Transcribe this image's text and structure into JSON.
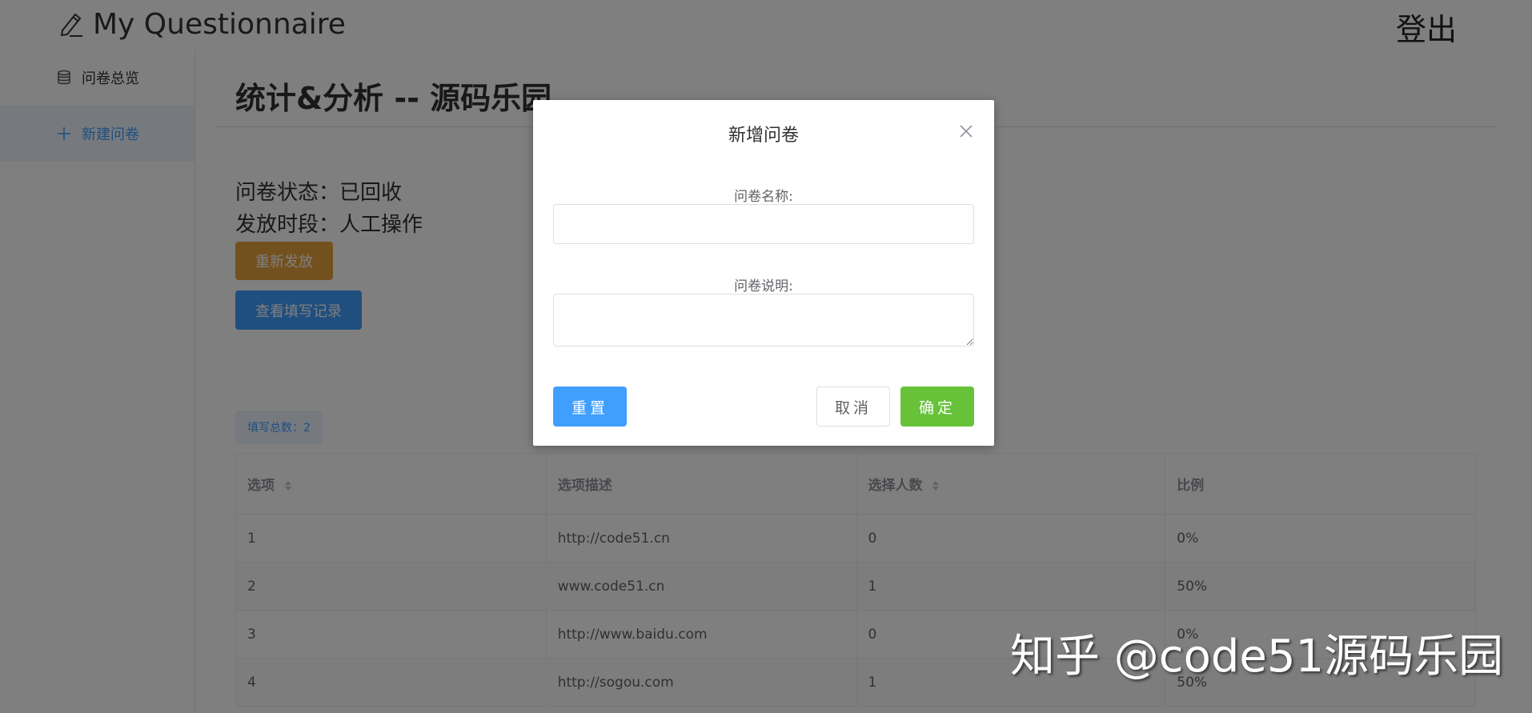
{
  "header": {
    "title": "My Questionnaire",
    "logout_label": "登出"
  },
  "sidebar": {
    "items": [
      {
        "label": "问卷总览",
        "icon": "database-icon",
        "active": false
      },
      {
        "label": "新建问卷",
        "icon": "plus-icon",
        "active": true
      }
    ]
  },
  "main": {
    "title": "统计&分析 -- 源码乐园",
    "status_line": "问卷状态：已回收",
    "period_line": "发放时段：人工操作",
    "redistribute_label": "重新发放",
    "view_records_label": "查看填写记录",
    "total_count_label": "填写总数：2",
    "table": {
      "columns": [
        "选项",
        "选项描述",
        "选择人数",
        "比例"
      ],
      "rows": [
        [
          "1",
          "http://code51.cn",
          "0",
          "0%"
        ],
        [
          "2",
          "www.code51.cn",
          "1",
          "50%"
        ],
        [
          "3",
          "http://www.baidu.com",
          "0",
          "0%"
        ],
        [
          "4",
          "http://sogou.com",
          "1",
          "50%"
        ]
      ]
    }
  },
  "dialog": {
    "title": "新增问卷",
    "name_label": "问卷名称:",
    "name_value": "",
    "desc_label": "问卷说明:",
    "desc_value": "",
    "reset_label": "重置",
    "cancel_label": "取消",
    "confirm_label": "确定"
  },
  "watermark": {
    "text": "知乎 @code51源码乐园"
  },
  "colors": {
    "primary": "#409eff",
    "warning": "#e6a23c",
    "success": "#67c23a",
    "overlay": "rgba(0,0,0,0.5)"
  }
}
